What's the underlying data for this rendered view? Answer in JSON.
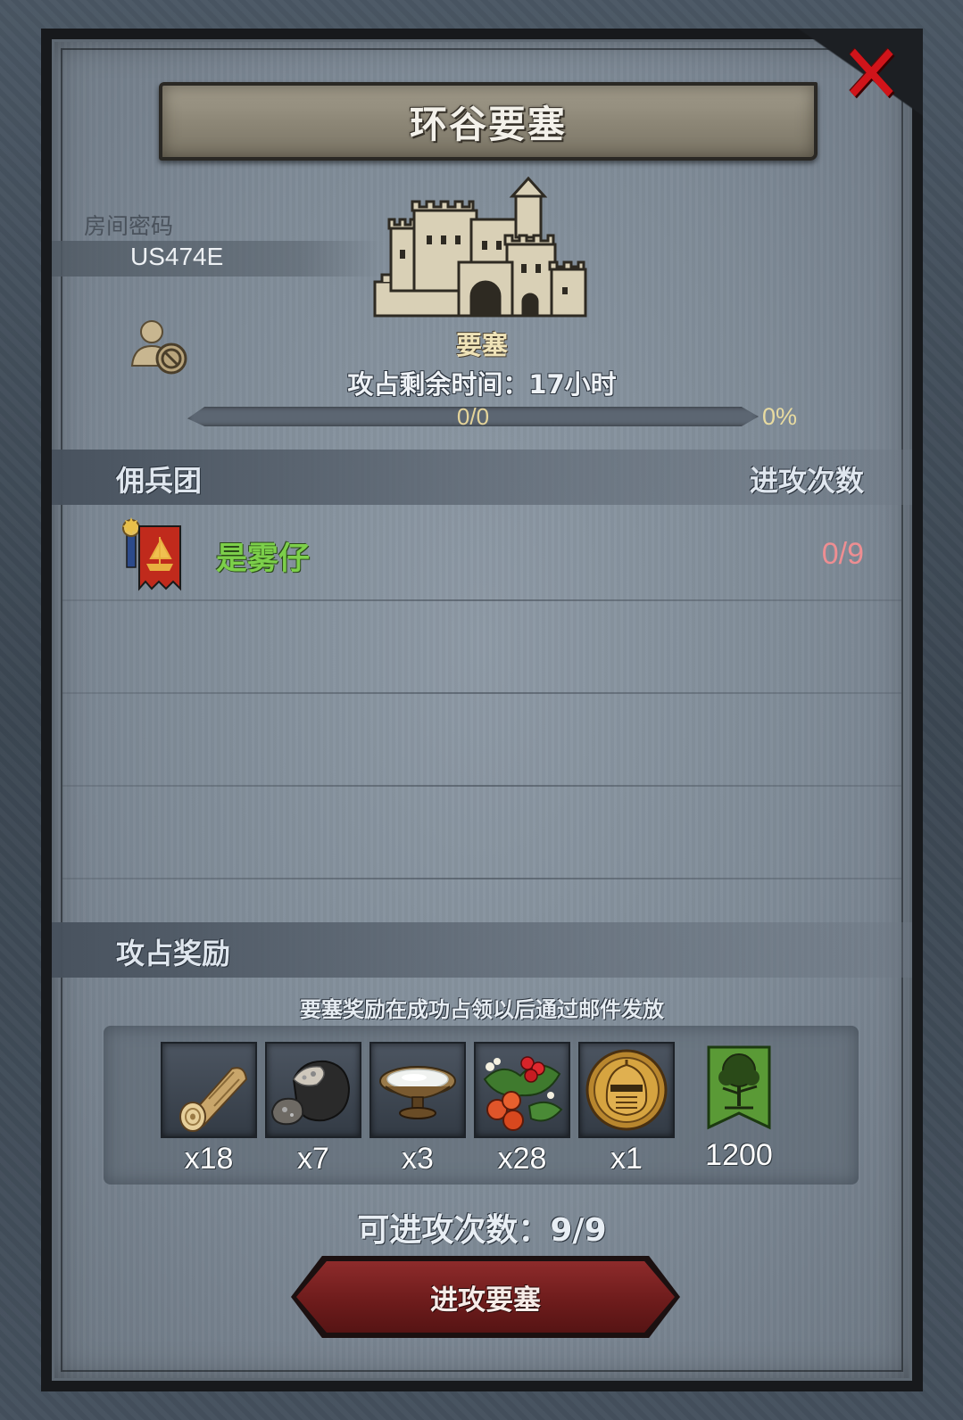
{
  "dialog": {
    "title": "环谷要塞",
    "close_icon": "close-icon"
  },
  "room": {
    "password_label": "房间密码",
    "password_value": "US474E",
    "privacy_icon": "user-blocked-icon"
  },
  "fortress": {
    "type_label": "要塞",
    "time_remaining": "攻占剩余时间：17小时",
    "progress_text": "0/0",
    "progress_percent_text": "0%",
    "progress_fraction": 0
  },
  "mercenaries": {
    "header": "佣兵团",
    "attacks_header": "进攻次数",
    "rows": [
      {
        "name": "是雾仔",
        "attacks": "0/9",
        "icon": "guild-banner-icon"
      }
    ]
  },
  "rewards": {
    "header": "攻占奖励",
    "note": "要塞奖励在成功占领以后通过邮件发放",
    "items": [
      {
        "icon": "wood-log-icon",
        "qty": "x18"
      },
      {
        "icon": "ore-icon",
        "qty": "x7"
      },
      {
        "icon": "bowl-icon",
        "qty": "x3"
      },
      {
        "icon": "berries-icon",
        "qty": "x28"
      },
      {
        "icon": "knight-helmet-icon",
        "qty": "x1"
      },
      {
        "icon": "tree-banner-icon",
        "qty": "1200"
      }
    ]
  },
  "attack": {
    "remaining": "可进攻次数：9/9",
    "button_label": "进攻要塞"
  },
  "colors": {
    "merc_name": "#7ccf4a",
    "attacks_value": "#ee8e92",
    "button": "#7a2020",
    "close": "#d0141a"
  }
}
